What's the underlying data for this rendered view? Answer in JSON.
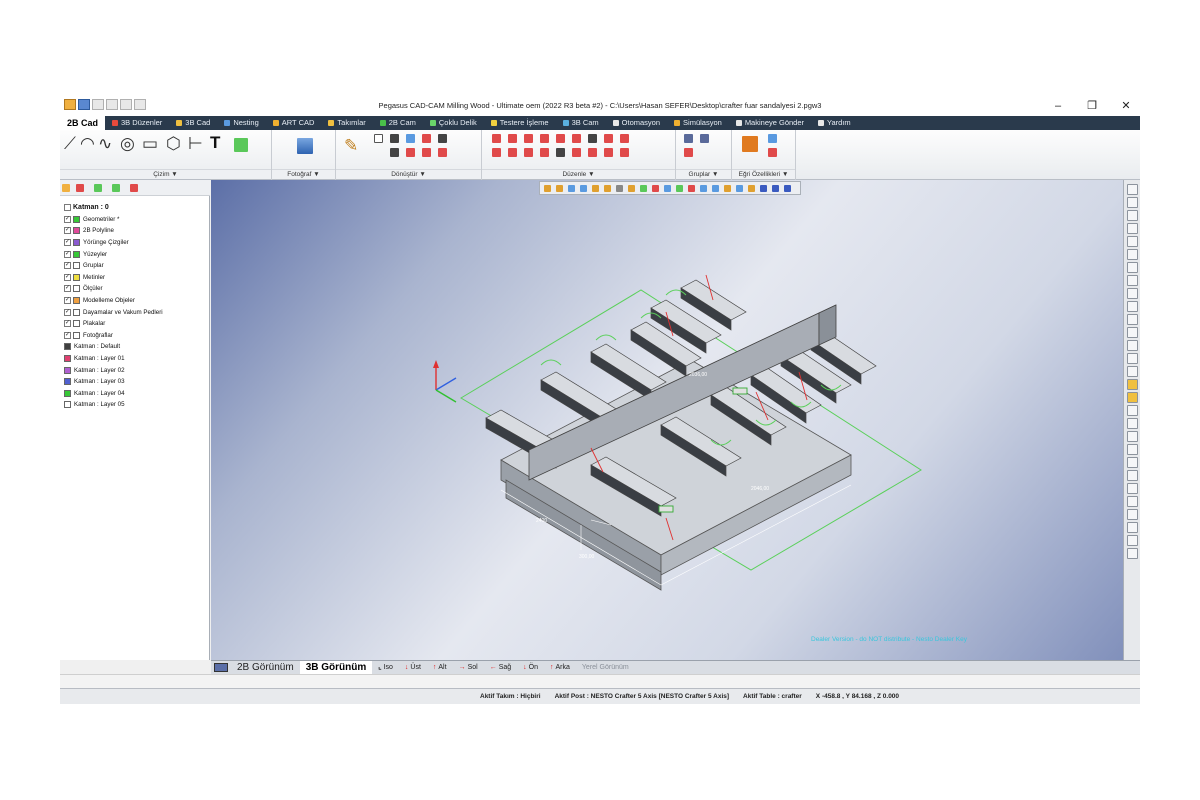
{
  "window": {
    "title": "Pegasus CAD-CAM Milling Wood - Ultimate oem (2022 R3 beta #2) - C:\\Users\\Hasan SEFER\\Desktop\\crafter fuar sandalyesi 2.pgw3",
    "minimize_symbol": "–",
    "maximize_symbol": "❐",
    "close_symbol": "✕"
  },
  "tabs": [
    {
      "label": "2B Cad",
      "active": true,
      "color": "#ffffff"
    },
    {
      "label": "3B Düzenler",
      "color": "#e84a3c"
    },
    {
      "label": "3B Cad",
      "color": "#f0c040"
    },
    {
      "label": "Nesting",
      "color": "#5a9ae0"
    },
    {
      "label": "ART CAD",
      "color": "#f0b030"
    },
    {
      "label": "Takımlar",
      "color": "#f0c040"
    },
    {
      "label": "2B Cam",
      "color": "#4ac04a"
    },
    {
      "label": "Çoklu Delik",
      "color": "#6ad46a"
    },
    {
      "label": "Testere İşleme",
      "color": "#f0d040"
    },
    {
      "label": "3B Cam",
      "color": "#5ab0e0"
    },
    {
      "label": "Otomasyon",
      "color": "#e8e8e8"
    },
    {
      "label": "Simülasyon",
      "color": "#f0b030"
    },
    {
      "label": "Makineye Gönder",
      "color": "#e8e8e8"
    },
    {
      "label": "Yardım",
      "color": "#e8e8e8"
    }
  ],
  "ribbon": {
    "groups": [
      "Çizim ▼",
      "Fotoğraf ▼",
      "Dönüştür ▼",
      "Düzenle ▼",
      "Gruplar ▼",
      "Eğri Özellikleri ▼"
    ],
    "text_tool_icon": "T"
  },
  "layers": {
    "root": "Katman : 0",
    "items": [
      {
        "label": "Geometriler *",
        "color": "#37c837",
        "checked": true
      },
      {
        "label": "2B Polyline",
        "color": "#e04a9a",
        "checked": true
      },
      {
        "label": "Yörünge Çizgiler",
        "color": "#8a5ad0",
        "checked": true
      },
      {
        "label": "Yüzeyler",
        "color": "#37c837",
        "checked": true
      },
      {
        "label": "Gruplar",
        "color": "#ffffff",
        "checked": true
      },
      {
        "label": "Metinler",
        "color": "#f0e040",
        "checked": true
      },
      {
        "label": "Ölçüler",
        "color": "#ffffff",
        "checked": true
      },
      {
        "label": "Modelleme Objeler",
        "color": "#f0a040",
        "checked": true
      },
      {
        "label": "Dayamalar ve Vakum Pedleri",
        "color": "#ffffff",
        "checked": true
      },
      {
        "label": "Plakalar",
        "color": "#ffffff",
        "checked": true
      },
      {
        "label": "Fotoğraflar",
        "color": "#ffffff",
        "checked": true
      }
    ],
    "named": [
      {
        "label": "Katman : Default",
        "color": "#404040"
      },
      {
        "label": "Katman : Layer 01",
        "color": "#e04070"
      },
      {
        "label": "Katman : Layer 02",
        "color": "#b060d0"
      },
      {
        "label": "Katman : Layer 03",
        "color": "#5060d0"
      },
      {
        "label": "Katman : Layer 04",
        "color": "#37c837"
      },
      {
        "label": "Katman : Layer 05",
        "color": "#ffffff"
      }
    ]
  },
  "viewport": {
    "watermark": "Dealer Version - do NOT distribute - Nesto Dealer Key",
    "dim_top": "2036,00",
    "dim_mid": "2046,00",
    "dim_side": "2400",
    "dim_end": "300,00"
  },
  "bottom_tabs": [
    {
      "label": "2B Görünüm",
      "big": true
    },
    {
      "label": "3B Görünüm",
      "big": true,
      "active": true
    },
    {
      "label": "Iso",
      "icon": "iso-icon"
    },
    {
      "label": "Üst",
      "icon": "arrow-down-icon"
    },
    {
      "label": "Alt",
      "icon": "arrow-up-icon"
    },
    {
      "label": "Sol",
      "icon": "arrow-right-icon"
    },
    {
      "label": "Sağ",
      "icon": "arrow-left-icon"
    },
    {
      "label": "Ön",
      "icon": "arrow-down-icon"
    },
    {
      "label": "Arka",
      "icon": "arrow-up-icon"
    },
    {
      "label": "Yerel Görünüm",
      "dim": true
    }
  ],
  "statusbar": {
    "tool": "Aktif Takım : Hiçbiri",
    "post": "Aktif Post : NESTO Crafter 5 Axis [NESTO Crafter 5 Axis]",
    "table": "Aktif Table : crafter",
    "coords": "X -458.8 ,  Y 84.168 ,  Z 0.000"
  }
}
